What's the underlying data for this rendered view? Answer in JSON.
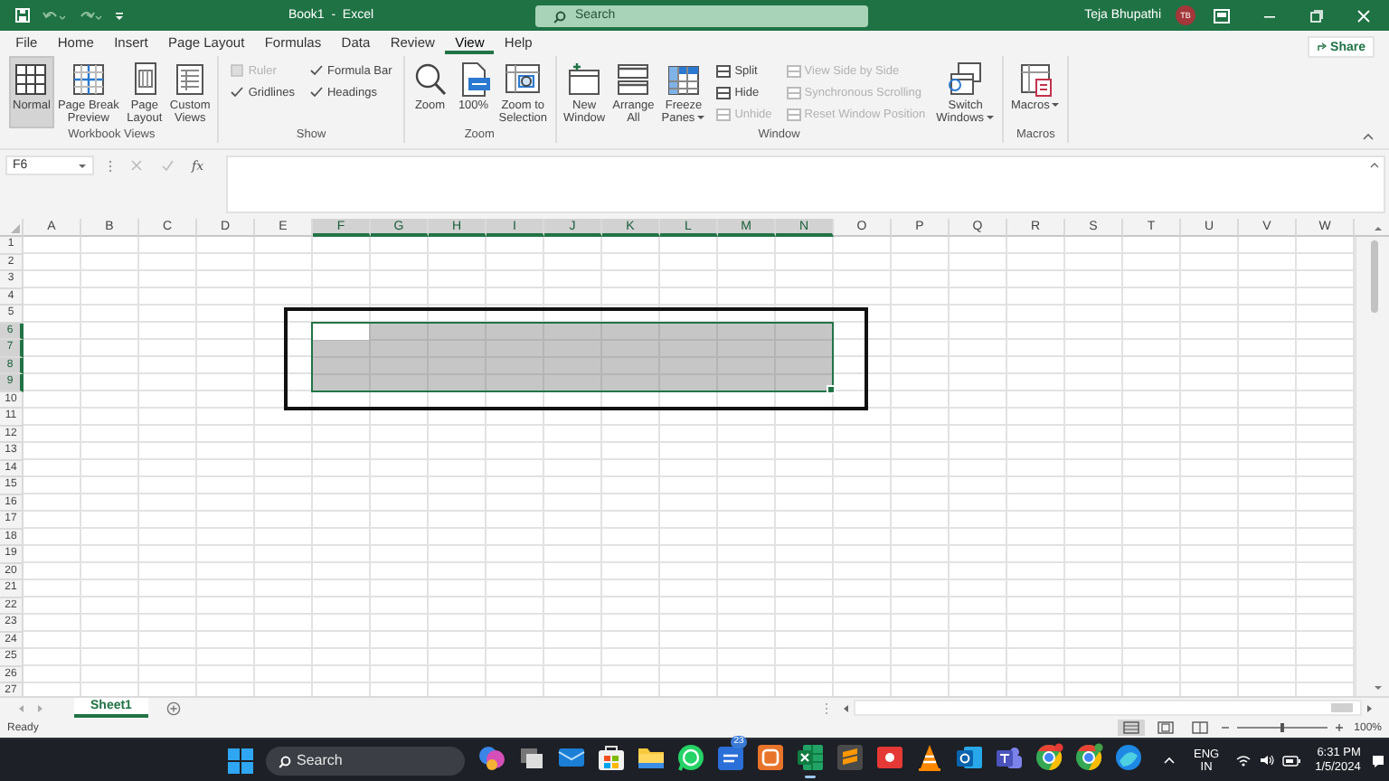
{
  "title_bar": {
    "title": "Book1  -  Excel",
    "search_placeholder": "Search",
    "user_name": "Teja Bhupathi",
    "avatar_initials": "TB"
  },
  "menu_tabs": [
    {
      "label": "File",
      "selected": false
    },
    {
      "label": "Home",
      "selected": false
    },
    {
      "label": "Insert",
      "selected": false
    },
    {
      "label": "Page Layout",
      "selected": false
    },
    {
      "label": "Formulas",
      "selected": false
    },
    {
      "label": "Data",
      "selected": false
    },
    {
      "label": "Review",
      "selected": false
    },
    {
      "label": "View",
      "selected": true
    },
    {
      "label": "Help",
      "selected": false
    }
  ],
  "share_button": "Share",
  "ribbon": {
    "groups": [
      {
        "label": "Workbook Views",
        "items": [
          {
            "kind": "large",
            "label": "Normal",
            "selected": true
          },
          {
            "kind": "large",
            "label": "Page Break\nPreview",
            "selected": false
          },
          {
            "kind": "large",
            "label": "Page\nLayout",
            "selected": false
          },
          {
            "kind": "large",
            "label": "Custom\nViews",
            "selected": false
          }
        ]
      },
      {
        "label": "Show",
        "items": [
          {
            "kind": "stack",
            "items": [
              {
                "kind": "checkbox",
                "label": "Ruler",
                "checked": false,
                "disabled": true
              },
              {
                "kind": "checkbox",
                "label": "Gridlines",
                "checked": true,
                "disabled": false
              }
            ]
          },
          {
            "kind": "stack",
            "items": [
              {
                "kind": "checkbox",
                "label": "Formula Bar",
                "checked": true,
                "disabled": false
              },
              {
                "kind": "checkbox",
                "label": "Headings",
                "checked": true,
                "disabled": false
              }
            ]
          }
        ]
      },
      {
        "label": "Zoom",
        "items": [
          {
            "kind": "large",
            "label": "Zoom"
          },
          {
            "kind": "large",
            "label": "100%"
          },
          {
            "kind": "large",
            "label": "Zoom to\nSelection"
          }
        ]
      },
      {
        "label": "Window",
        "items": [
          {
            "kind": "large",
            "label": "New\nWindow"
          },
          {
            "kind": "large",
            "label": "Arrange\nAll"
          },
          {
            "kind": "large",
            "label": "Freeze\nPanes",
            "dropdown": true
          },
          {
            "kind": "stack",
            "items": [
              {
                "kind": "small",
                "label": "Split",
                "disabled": false
              },
              {
                "kind": "small",
                "label": "Hide",
                "disabled": false
              },
              {
                "kind": "small",
                "label": "Unhide",
                "disabled": true
              }
            ]
          },
          {
            "kind": "stack",
            "items": [
              {
                "kind": "small",
                "label": "View Side by Side",
                "disabled": true
              },
              {
                "kind": "small",
                "label": "Synchronous Scrolling",
                "disabled": true
              },
              {
                "kind": "small",
                "label": "Reset Window Position",
                "disabled": true
              }
            ]
          },
          {
            "kind": "large",
            "label": "Switch\nWindows",
            "dropdown": true
          }
        ]
      },
      {
        "label": "Macros",
        "items": [
          {
            "kind": "large",
            "label": "Macros",
            "dropdown": true
          }
        ]
      }
    ]
  },
  "formula_bar": {
    "name_box": "F6",
    "function_button": "fx"
  },
  "sheet": {
    "columns": [
      {
        "label": "A",
        "selected": false
      },
      {
        "label": "B",
        "selected": false
      },
      {
        "label": "C",
        "selected": false
      },
      {
        "label": "D",
        "selected": false
      },
      {
        "label": "E",
        "selected": false
      },
      {
        "label": "F",
        "selected": true
      },
      {
        "label": "G",
        "selected": true
      },
      {
        "label": "H",
        "selected": true
      },
      {
        "label": "I",
        "selected": true
      },
      {
        "label": "J",
        "selected": true
      },
      {
        "label": "K",
        "selected": true
      },
      {
        "label": "L",
        "selected": true
      },
      {
        "label": "M",
        "selected": true
      },
      {
        "label": "N",
        "selected": true
      },
      {
        "label": "O",
        "selected": false
      },
      {
        "label": "P",
        "selected": false
      },
      {
        "label": "Q",
        "selected": false
      },
      {
        "label": "R",
        "selected": false
      },
      {
        "label": "S",
        "selected": false
      },
      {
        "label": "T",
        "selected": false
      },
      {
        "label": "U",
        "selected": false
      },
      {
        "label": "V",
        "selected": false
      },
      {
        "label": "W",
        "selected": false
      }
    ],
    "rows": [
      {
        "label": "1",
        "selected": false
      },
      {
        "label": "2",
        "selected": false
      },
      {
        "label": "3",
        "selected": false
      },
      {
        "label": "4",
        "selected": false
      },
      {
        "label": "5",
        "selected": false
      },
      {
        "label": "6",
        "selected": true
      },
      {
        "label": "7",
        "selected": true
      },
      {
        "label": "8",
        "selected": true
      },
      {
        "label": "9",
        "selected": true
      },
      {
        "label": "10",
        "selected": false
      },
      {
        "label": "11",
        "selected": false
      },
      {
        "label": "12",
        "selected": false
      },
      {
        "label": "13",
        "selected": false
      },
      {
        "label": "14",
        "selected": false
      },
      {
        "label": "15",
        "selected": false
      },
      {
        "label": "16",
        "selected": false
      },
      {
        "label": "17",
        "selected": false
      },
      {
        "label": "18",
        "selected": false
      },
      {
        "label": "19",
        "selected": false
      },
      {
        "label": "20",
        "selected": false
      },
      {
        "label": "21",
        "selected": false
      },
      {
        "label": "22",
        "selected": false
      },
      {
        "label": "23",
        "selected": false
      },
      {
        "label": "24",
        "selected": false
      },
      {
        "label": "25",
        "selected": false
      },
      {
        "label": "26",
        "selected": false
      },
      {
        "label": "27",
        "selected": false
      }
    ],
    "highlight_box": {
      "kind": "rectangle"
    }
  },
  "sheet_tabs": [
    {
      "label": "Sheet1",
      "selected": true
    }
  ],
  "status_bar": {
    "status": "Ready",
    "view_buttons": [
      {
        "selected": true
      },
      {
        "selected": false
      },
      {
        "selected": false
      }
    ],
    "zoom_slider": {
      "level": 0.5
    },
    "zoom": "100%"
  },
  "taskbar": {
    "search_placeholder": "Search",
    "apps": [
      {
        "active": false
      },
      {
        "active": false
      },
      {
        "active": false
      },
      {
        "active": false
      },
      {
        "active": false
      },
      {
        "active": false
      },
      {
        "active": false,
        "badge": "23"
      },
      {
        "active": false
      },
      {
        "active": true
      },
      {
        "active": false
      },
      {
        "active": false
      },
      {
        "active": false
      },
      {
        "active": false
      },
      {
        "active": false
      },
      {
        "active": false
      },
      {
        "active": false
      },
      {
        "active": false
      }
    ],
    "tray": {
      "language": "ENG",
      "region": "IN",
      "time": "6:31 PM",
      "date": "1/5/2024"
    }
  }
}
